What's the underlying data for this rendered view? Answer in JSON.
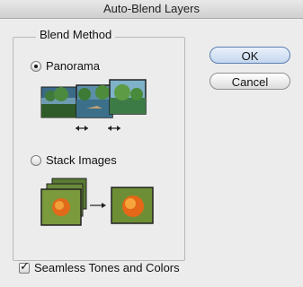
{
  "window": {
    "title": "Auto-Blend Layers"
  },
  "blend_method": {
    "label": "Blend Method",
    "options": [
      {
        "label": "Panorama",
        "selected": true
      },
      {
        "label": "Stack Images",
        "selected": false
      }
    ]
  },
  "buttons": {
    "ok_label": "OK",
    "cancel_label": "Cancel"
  },
  "seamless": {
    "label": "Seamless Tones and Colors",
    "checked": true
  },
  "icons": {
    "panorama_illustration": "panorama-icon",
    "stack_illustration": "stack-images-icon"
  }
}
